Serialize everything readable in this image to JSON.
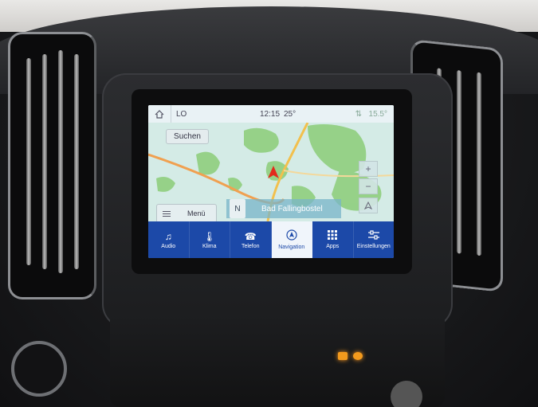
{
  "status_bar": {
    "source": "LO",
    "time": "12:15",
    "inside_temp": "25°",
    "outside_temp": "15.5°",
    "home_icon": "home-icon"
  },
  "map": {
    "search_label": "Suchen",
    "zoom_in": "+",
    "zoom_out": "−",
    "menu_label": "Menü",
    "compass": "N",
    "current_location": "Bad Fallingbostel",
    "colors": {
      "water": "#cfe6e8",
      "forest": "#8fcf7e",
      "road_main": "#f2c04d",
      "road_secondary": "#f0a050",
      "vehicle": "#e22b1c"
    }
  },
  "tabs": [
    {
      "label": "Audio",
      "icon": "music-icon",
      "active": false
    },
    {
      "label": "Klima",
      "icon": "thermometer-icon",
      "active": false
    },
    {
      "label": "Telefon",
      "icon": "phone-icon",
      "active": false
    },
    {
      "label": "Navigation",
      "icon": "navigation-icon",
      "active": true
    },
    {
      "label": "Apps",
      "icon": "apps-grid-icon",
      "active": false
    },
    {
      "label": "Einstellungen",
      "icon": "sliders-icon",
      "active": false
    }
  ],
  "colors": {
    "tab_bar": "#1c49a8",
    "tab_active_bg": "#f0f5fb",
    "hazard_led": "#f39a1d"
  }
}
